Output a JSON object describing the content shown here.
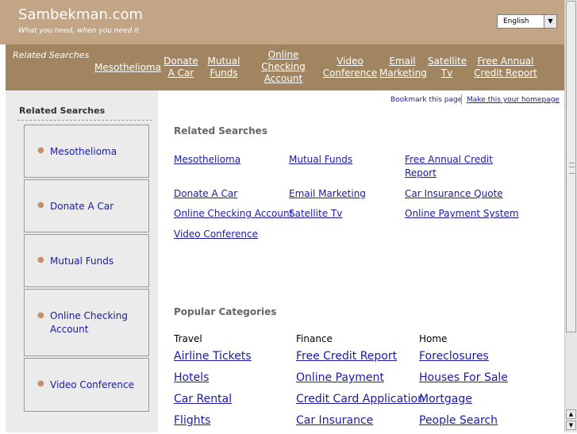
{
  "header": {
    "site_title": "Sambekman.com",
    "tagline": "What you need, when you need it",
    "language": "English"
  },
  "nav": {
    "label": "Related Searches",
    "links": [
      "Mesothelioma",
      "Donate A Car",
      "Mutual Funds",
      "Online Checking Account",
      "Video Conference",
      "Email Marketing",
      "Satellite Tv",
      "Free Annual Credit Report"
    ]
  },
  "sidebar": {
    "title": "Related Searches",
    "items": [
      "Mesothelioma",
      "Donate A Car",
      "Mutual Funds",
      "Online Checking Account",
      "Video Conference"
    ]
  },
  "bookmark": {
    "bookmark_label": "Bookmark this page",
    "homepage_label": "Make this your homepage"
  },
  "related": {
    "title": "Related Searches",
    "links": [
      "Mesothelioma",
      "Mutual Funds",
      "Free Annual Credit Report",
      "Donate A Car",
      "Email Marketing",
      "Car Insurance Quote",
      "Online Checking Account",
      "Satellite Tv",
      "Online Payment System",
      "Video Conference"
    ]
  },
  "popular": {
    "title": "Popular Categories",
    "categories": [
      {
        "name": "Travel",
        "links": [
          "Airline Tickets",
          "Hotels",
          "Car Rental",
          "Flights"
        ]
      },
      {
        "name": "Finance",
        "links": [
          "Free Credit Report",
          "Online Payment",
          "Credit Card Application",
          "Car Insurance"
        ]
      },
      {
        "name": "Home",
        "links": [
          "Foreclosures",
          "Houses For Sale",
          "Mortgage",
          "People Search"
        ]
      }
    ]
  },
  "icons": {
    "dropdown": "chevron-down-icon",
    "bullet": "bullet-icon",
    "scroll_up": "arrow-up-icon",
    "scroll_down": "arrow-down-icon"
  },
  "colors": {
    "header_bg": "#c2a584",
    "nav_bg": "#a18460",
    "sidebar_bg": "#ebebeb",
    "link": "#1a1aa6"
  }
}
